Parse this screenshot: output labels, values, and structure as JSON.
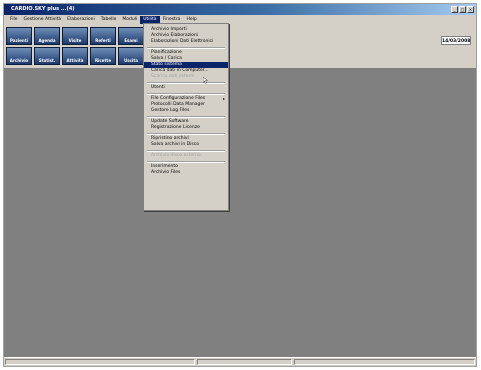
{
  "window": {
    "title": "CARDIO.SKY plus ...(4)",
    "minimize": "_",
    "maximize": "□",
    "close": "×"
  },
  "menubar": [
    {
      "label": "File"
    },
    {
      "label": "Gestione Attività"
    },
    {
      "label": "Elaborazioni"
    },
    {
      "label": "Tabelle"
    },
    {
      "label": "Moduli"
    },
    {
      "label": "Utilità"
    },
    {
      "label": "Finestra"
    },
    {
      "label": "Help"
    }
  ],
  "active_menu": "Utilità",
  "toolbar": {
    "tiles": [
      {
        "label": "Pazienti"
      },
      {
        "label": "Agenda"
      },
      {
        "label": "Visite"
      },
      {
        "label": "Referti"
      },
      {
        "label": "Esami"
      },
      {
        "label": "Archivio"
      },
      {
        "label": "Statist."
      },
      {
        "label": "Attività"
      },
      {
        "label": "Ricette"
      },
      {
        "label": "Uscita"
      }
    ],
    "date": "14/03/2008"
  },
  "dropdown": [
    {
      "label": "Archivio Importi",
      "type": "item"
    },
    {
      "label": "Archivio Elaborazioni",
      "type": "item"
    },
    {
      "label": "Elaborazioni Dati Elettronici",
      "type": "item"
    },
    {
      "type": "sep"
    },
    {
      "label": "Pianificazione",
      "type": "item"
    },
    {
      "label": "Salva / Carica",
      "type": "item"
    },
    {
      "label": "Stato sistema",
      "type": "item",
      "selected": true
    },
    {
      "label": "Carica dati in Computer...",
      "type": "item"
    },
    {
      "label": "Scarico dati esterni",
      "type": "item",
      "disabled": true
    },
    {
      "type": "sep"
    },
    {
      "label": "Utenti",
      "type": "item"
    },
    {
      "type": "sep"
    },
    {
      "label": "File Configurazione Files",
      "type": "item",
      "submenu": true
    },
    {
      "label": "Protocolli Data Manager",
      "type": "item"
    },
    {
      "label": "Gestore Log Files",
      "type": "item"
    },
    {
      "type": "sep"
    },
    {
      "label": "Update Software",
      "type": "item"
    },
    {
      "label": "Registrazione Licenze",
      "type": "item"
    },
    {
      "type": "sep"
    },
    {
      "label": "Ripristino archivi",
      "type": "item"
    },
    {
      "label": "Salva archivi in Disco",
      "type": "item"
    },
    {
      "type": "sep"
    },
    {
      "label": "Archivio disco esterno",
      "type": "item",
      "disabled": true
    },
    {
      "type": "sep"
    },
    {
      "label": "Inserimento",
      "type": "item"
    },
    {
      "label": "Archivio Files",
      "type": "item"
    }
  ],
  "colors": {
    "accent": "#0a246a",
    "workspace": "#808080",
    "chrome": "#d4d0c8"
  }
}
